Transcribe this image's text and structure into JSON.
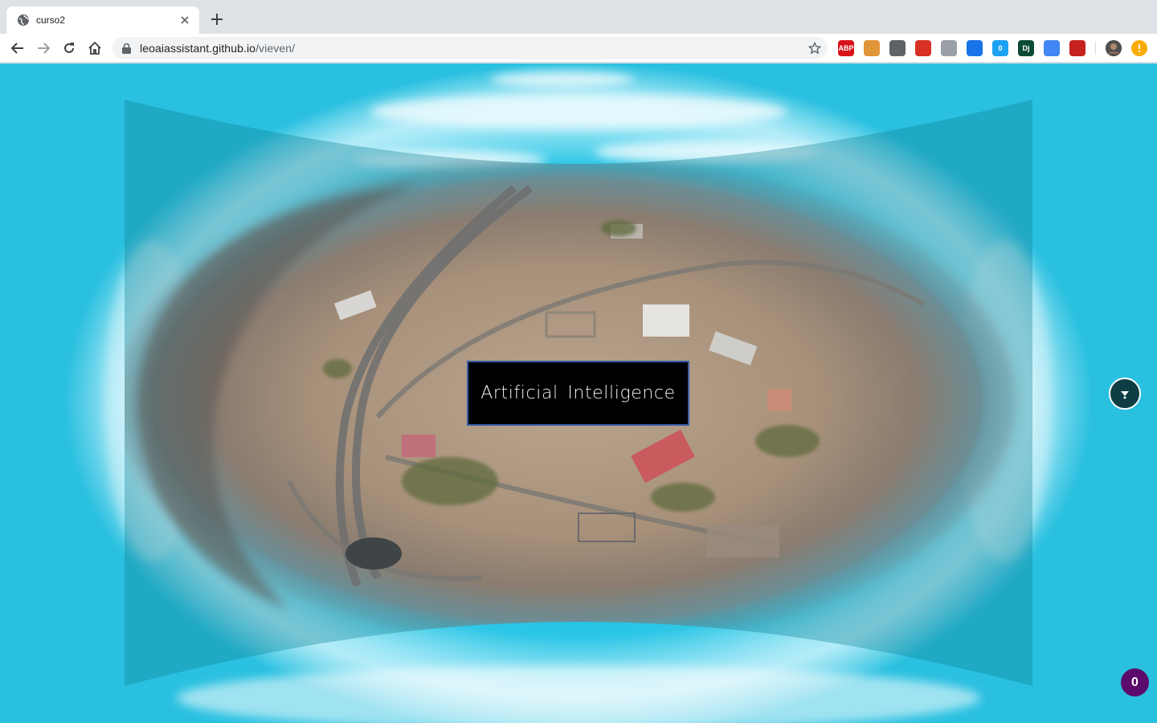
{
  "browser": {
    "tab": {
      "title": "curso2"
    },
    "address": {
      "host": "leoaiassistant.github.io",
      "path": "/vieven/"
    },
    "extensions": [
      {
        "name": "abp-icon",
        "label": "ABP",
        "color": "#d7121a"
      },
      {
        "name": "cookie-icon",
        "label": "",
        "color": "#e0953a"
      },
      {
        "name": "circle-ext-icon",
        "label": "",
        "color": "#5f6368"
      },
      {
        "name": "pdf-icon",
        "label": "",
        "color": "#d93025"
      },
      {
        "name": "eyedropper-icon",
        "label": "",
        "color": "#9aa0a6"
      },
      {
        "name": "pulse-icon",
        "label": "",
        "color": "#1a73e8"
      },
      {
        "name": "robot-icon",
        "label": "0",
        "color": "#1da1f2"
      },
      {
        "name": "dj-icon",
        "label": "Dj",
        "color": "#0c4b33"
      },
      {
        "name": "window-ext-icon",
        "label": "",
        "color": "#4285f4"
      },
      {
        "name": "media-ext-icon",
        "label": "",
        "color": "#c5221f"
      }
    ]
  },
  "page": {
    "title_box": "Artificial Intelligence",
    "badge_count": "0"
  }
}
